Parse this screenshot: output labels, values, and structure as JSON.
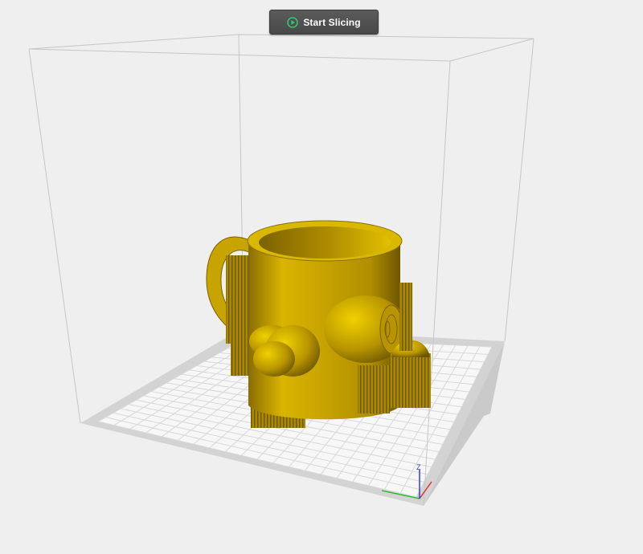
{
  "toolbar": {
    "start_slicing_label": "Start Slicing",
    "start_slicing_icon": "play-circle-icon",
    "icon_color": "#2ecc71"
  },
  "viewport": {
    "background": "#efefef",
    "build_volume_color": "#c4c4c4",
    "bed_color": "#f7f7f7",
    "bed_border_color": "#d6d6d6",
    "model_color": "#c8a400",
    "model_name": "mug"
  },
  "axes": {
    "z_label": "Z",
    "x_color": "#e23030",
    "y_color": "#2ebd2e",
    "z_color": "#2d3fd6"
  }
}
